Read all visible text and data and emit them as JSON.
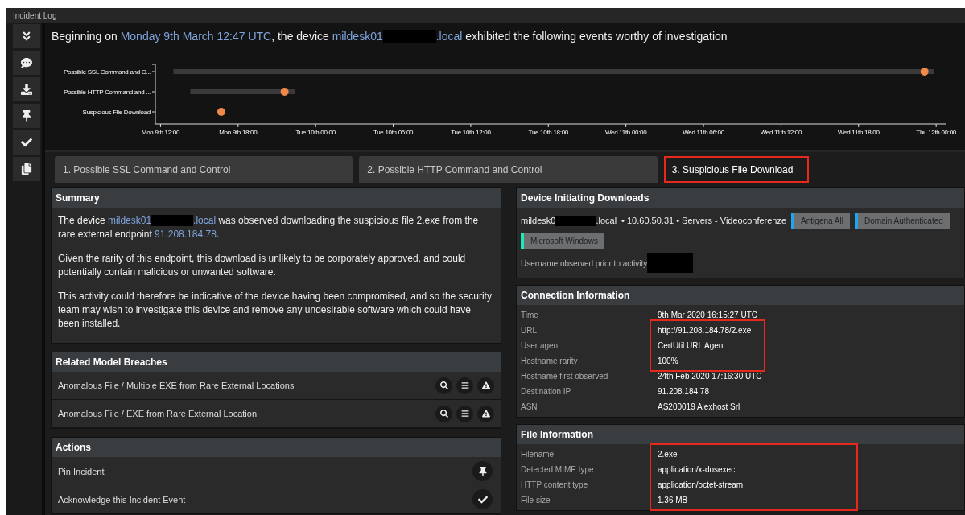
{
  "window": {
    "title": "Incident Log"
  },
  "sidebar": {
    "buttons": [
      {
        "kind": "collapse"
      },
      {
        "kind": "comment"
      },
      {
        "kind": "download"
      },
      {
        "kind": "pin"
      },
      {
        "kind": "acknowledge"
      },
      {
        "kind": "copy"
      }
    ]
  },
  "headline": [
    {
      "kind": "text",
      "text": "Beginning on "
    },
    {
      "kind": "link",
      "text": "Monday 9th March 12:47 UTC"
    },
    {
      "kind": "text",
      "text": ", the device "
    },
    {
      "kind": "link",
      "text": "mildesk01"
    },
    {
      "kind": "redacted"
    },
    {
      "kind": "link",
      "text": ".local"
    },
    {
      "kind": "text",
      "text": " exhibited the following events worthy of investigation"
    }
  ],
  "timeline": {
    "rows": [
      "Possible SSL Command and C...",
      "Possible HTTP Command and ...",
      "Suspicious File Download"
    ],
    "ticks": [
      "Mon 9th 12:00",
      "Mon 9th 18:00",
      "Tue 10th 00:00",
      "Tue 10th 06:00",
      "Tue 10th 12:00",
      "Tue 10th 18:00",
      "Wed 11th 00:00",
      "Wed 11th 06:00",
      "Wed 11th 12:00",
      "Wed 11th 18:00",
      "Thu 12th 00:00"
    ]
  },
  "tabs": [
    {
      "label": "1. Possible SSL Command and Control",
      "selected": false,
      "annotated": false
    },
    {
      "label": "2. Possible HTTP Command and Control",
      "selected": false,
      "annotated": false
    },
    {
      "label": "3. Suspicious File Download",
      "selected": true,
      "annotated": true
    }
  ],
  "summary": {
    "title": "Summary",
    "paragraphs": [
      [
        {
          "kind": "text",
          "text": "The device "
        },
        {
          "kind": "link",
          "text": "mildesk01"
        },
        {
          "kind": "redacted"
        },
        {
          "kind": "link",
          "text": ".local"
        },
        {
          "kind": "text",
          "text": " was observed downloading the suspicious file 2.exe from the rare external endpoint "
        },
        {
          "kind": "link",
          "text": "91.208.184.78"
        },
        {
          "kind": "text",
          "text": "."
        }
      ],
      [
        {
          "kind": "text",
          "text": "Given the rarity of this endpoint, this download is unlikely to be corporately approved, and could potentially contain malicious or unwanted software."
        }
      ],
      [
        {
          "kind": "text",
          "text": "This activity could therefore be indicative of the device having been compromised, and so the security team may wish to investigate this device and remove any undesirable software which could have been installed."
        }
      ]
    ]
  },
  "breaches": {
    "title": "Related Model Breaches",
    "items": [
      "Anomalous File / Multiple EXE from Rare External Locations",
      "Anomalous File / EXE from Rare External Location"
    ]
  },
  "actions": {
    "title": "Actions",
    "items": [
      {
        "label": "Pin Incident",
        "kind": "pin"
      },
      {
        "label": "Acknowledge this Incident Event",
        "kind": "acknowledge"
      }
    ]
  },
  "device": {
    "title": "Device Initiating Downloads",
    "host_prefix": "mildesk0",
    "host_suffix": ".local",
    "details": "• 10.60.50.31 • Servers - Videoconferenze",
    "tags": [
      {
        "label": "Antigena All",
        "color": "#1ea7f0"
      },
      {
        "label": "Domain Authenticated",
        "color": "#1ea7f0"
      },
      {
        "label": "Microsoft Windows",
        "color": "#1de9b6"
      }
    ],
    "username_label": "Username observed prior to activity"
  },
  "connection": {
    "title": "Connection Information",
    "groups": [
      {
        "annotated": false,
        "rows": [
          {
            "label": "Time",
            "value": "9th Mar 2020 16:15:27 UTC"
          }
        ]
      },
      {
        "annotated": true,
        "rows": [
          {
            "label": "URL",
            "value": "http://91.208.184.78/2.exe"
          },
          {
            "label": "User agent",
            "value": "CertUtil URL Agent"
          },
          {
            "label": "Hostname rarity",
            "value": "100%"
          }
        ]
      },
      {
        "annotated": false,
        "rows": [
          {
            "label": "Hostname first observed",
            "value": "24th Feb 2020 17:16:30 UTC"
          },
          {
            "label": "Destination IP",
            "value": "91.208.184.78"
          },
          {
            "label": "ASN",
            "value": "AS200019 Alexhost Srl"
          }
        ]
      }
    ]
  },
  "file": {
    "title": "File Information",
    "groups": [
      {
        "annotated": true,
        "rows": [
          {
            "label": "Filename",
            "value": "2.exe"
          },
          {
            "label": "Detected MIME type",
            "value": "application/x-dosexec"
          },
          {
            "label": "HTTP content type",
            "value": "application/octet-stream"
          },
          {
            "label": "File size",
            "value": "1.36 MB"
          }
        ]
      }
    ]
  }
}
